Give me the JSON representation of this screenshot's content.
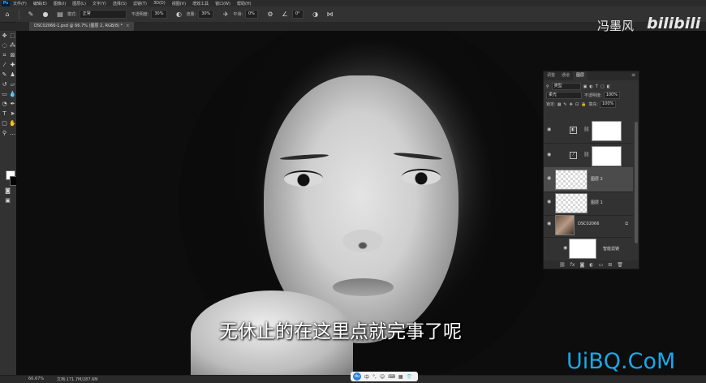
{
  "app": {
    "logo": "Ps"
  },
  "menu": [
    "文件(F)",
    "编辑(E)",
    "图像(I)",
    "图层(L)",
    "文字(Y)",
    "选择(S)",
    "滤镜(T)",
    "3D(D)",
    "视图(V)",
    "增效工具",
    "窗口(W)",
    "帮助(H)"
  ],
  "options": {
    "mode_label": "模式:",
    "mode_value": "正常",
    "opacity_label": "不透明度:",
    "opacity_value": "30%",
    "flow_label": "流量:",
    "flow_value": "30%",
    "smooth_label": "平滑:",
    "smooth_value": "0%",
    "angle_value": "0°",
    "icons": [
      "home-icon",
      "brush-icon",
      "brush-preset-icon",
      "brush-settings-icon",
      "pressure-icon",
      "airbrush-icon",
      "settings-icon",
      "angle-icon",
      "symmetry-icon"
    ]
  },
  "document": {
    "tab_title": "DSC02066-1.psd @ 66.7% (图层 2, RGB/8) *",
    "close_glyph": "×"
  },
  "tools": [
    "move-icon",
    "marquee-icon",
    "lasso-icon",
    "magic-wand-icon",
    "crop-icon",
    "frame-icon",
    "eyedropper-icon",
    "healing-icon",
    "brush-icon",
    "stamp-icon",
    "history-brush-icon",
    "eraser-icon",
    "gradient-icon",
    "blur-icon",
    "dodge-icon",
    "pen-icon",
    "type-icon",
    "path-select-icon",
    "shape-icon",
    "hand-icon",
    "zoom-icon",
    "more-icon"
  ],
  "colors": {
    "foreground": "#ffffff",
    "background": "#000000",
    "watermark_blue": "#1ca7e8"
  },
  "watermark": {
    "author": "冯墨风",
    "site_logo": "bilibili",
    "uibq": "UiBQ.CoM"
  },
  "subtitle": "无休止的在这里点就完事了呢",
  "layers_panel": {
    "tabs": [
      "调整",
      "通道",
      "图层"
    ],
    "active_tab": "图层",
    "kind_filter": "类型",
    "blend_mode": "柔光",
    "opacity_label": "不透明度:",
    "opacity_value": "100%",
    "lock_label": "锁定:",
    "fill_label": "填充:",
    "fill_value": "100%",
    "layers": [
      {
        "name": "",
        "type": "adjustment",
        "selected": false
      },
      {
        "name": "",
        "type": "adjustment",
        "selected": false
      },
      {
        "name": "图层 2",
        "type": "pixel",
        "selected": true
      },
      {
        "name": "图层 1",
        "type": "pixel",
        "selected": false
      },
      {
        "name": "DSC02066",
        "type": "photo",
        "selected": false
      }
    ],
    "smart_filter_label": "智能滤镜",
    "footer_icons": [
      "link-icon",
      "fx-icon",
      "mask-icon",
      "adjustment-icon",
      "group-icon",
      "new-layer-icon",
      "trash-icon"
    ]
  },
  "status": {
    "zoom": "66.67%",
    "doc_info": "文档:171.7M/287.6M"
  },
  "ime": {
    "labels": [
      "中",
      "°,",
      "☺",
      "⌨",
      "▦",
      "👕"
    ]
  }
}
